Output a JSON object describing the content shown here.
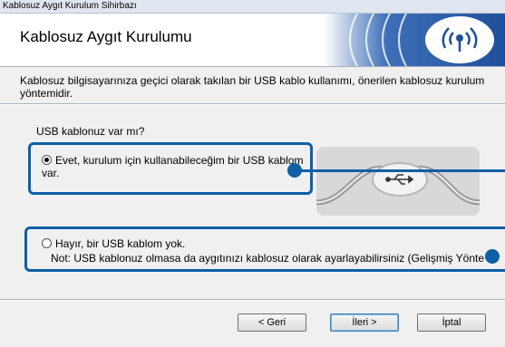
{
  "window": {
    "title": "Kablosuz Aygıt Kurulum Sihirbazı"
  },
  "header": {
    "title": "Kablosuz Aygıt Kurulumu"
  },
  "intro": "Kablosuz bilgisayarınıza geçici olarak takılan bir USB kablo kullanımı, önerilen kablosuz kurulum yöntemidir.",
  "question": "USB kablonuz var mı?",
  "options": [
    {
      "label": "Evet, kurulum için kullanabileceğim bir USB kablom var.",
      "selected": true
    },
    {
      "label": "Hayır, bir USB kablom yok.",
      "selected": false
    }
  ],
  "note": "Not: USB kablonuz olmasa da aygıtınızı kablosuz olarak ayarlayabilirsiniz (Gelişmiş Yönte",
  "buttons": {
    "back": "< Geri",
    "next": "İleri >",
    "cancel": "İptal"
  },
  "colors": {
    "highlight": "#0d5fa6",
    "logo_blue": "#1f4f9c"
  },
  "icons": {
    "logo": "wireless-signal-icon",
    "usb": "usb-icon"
  }
}
